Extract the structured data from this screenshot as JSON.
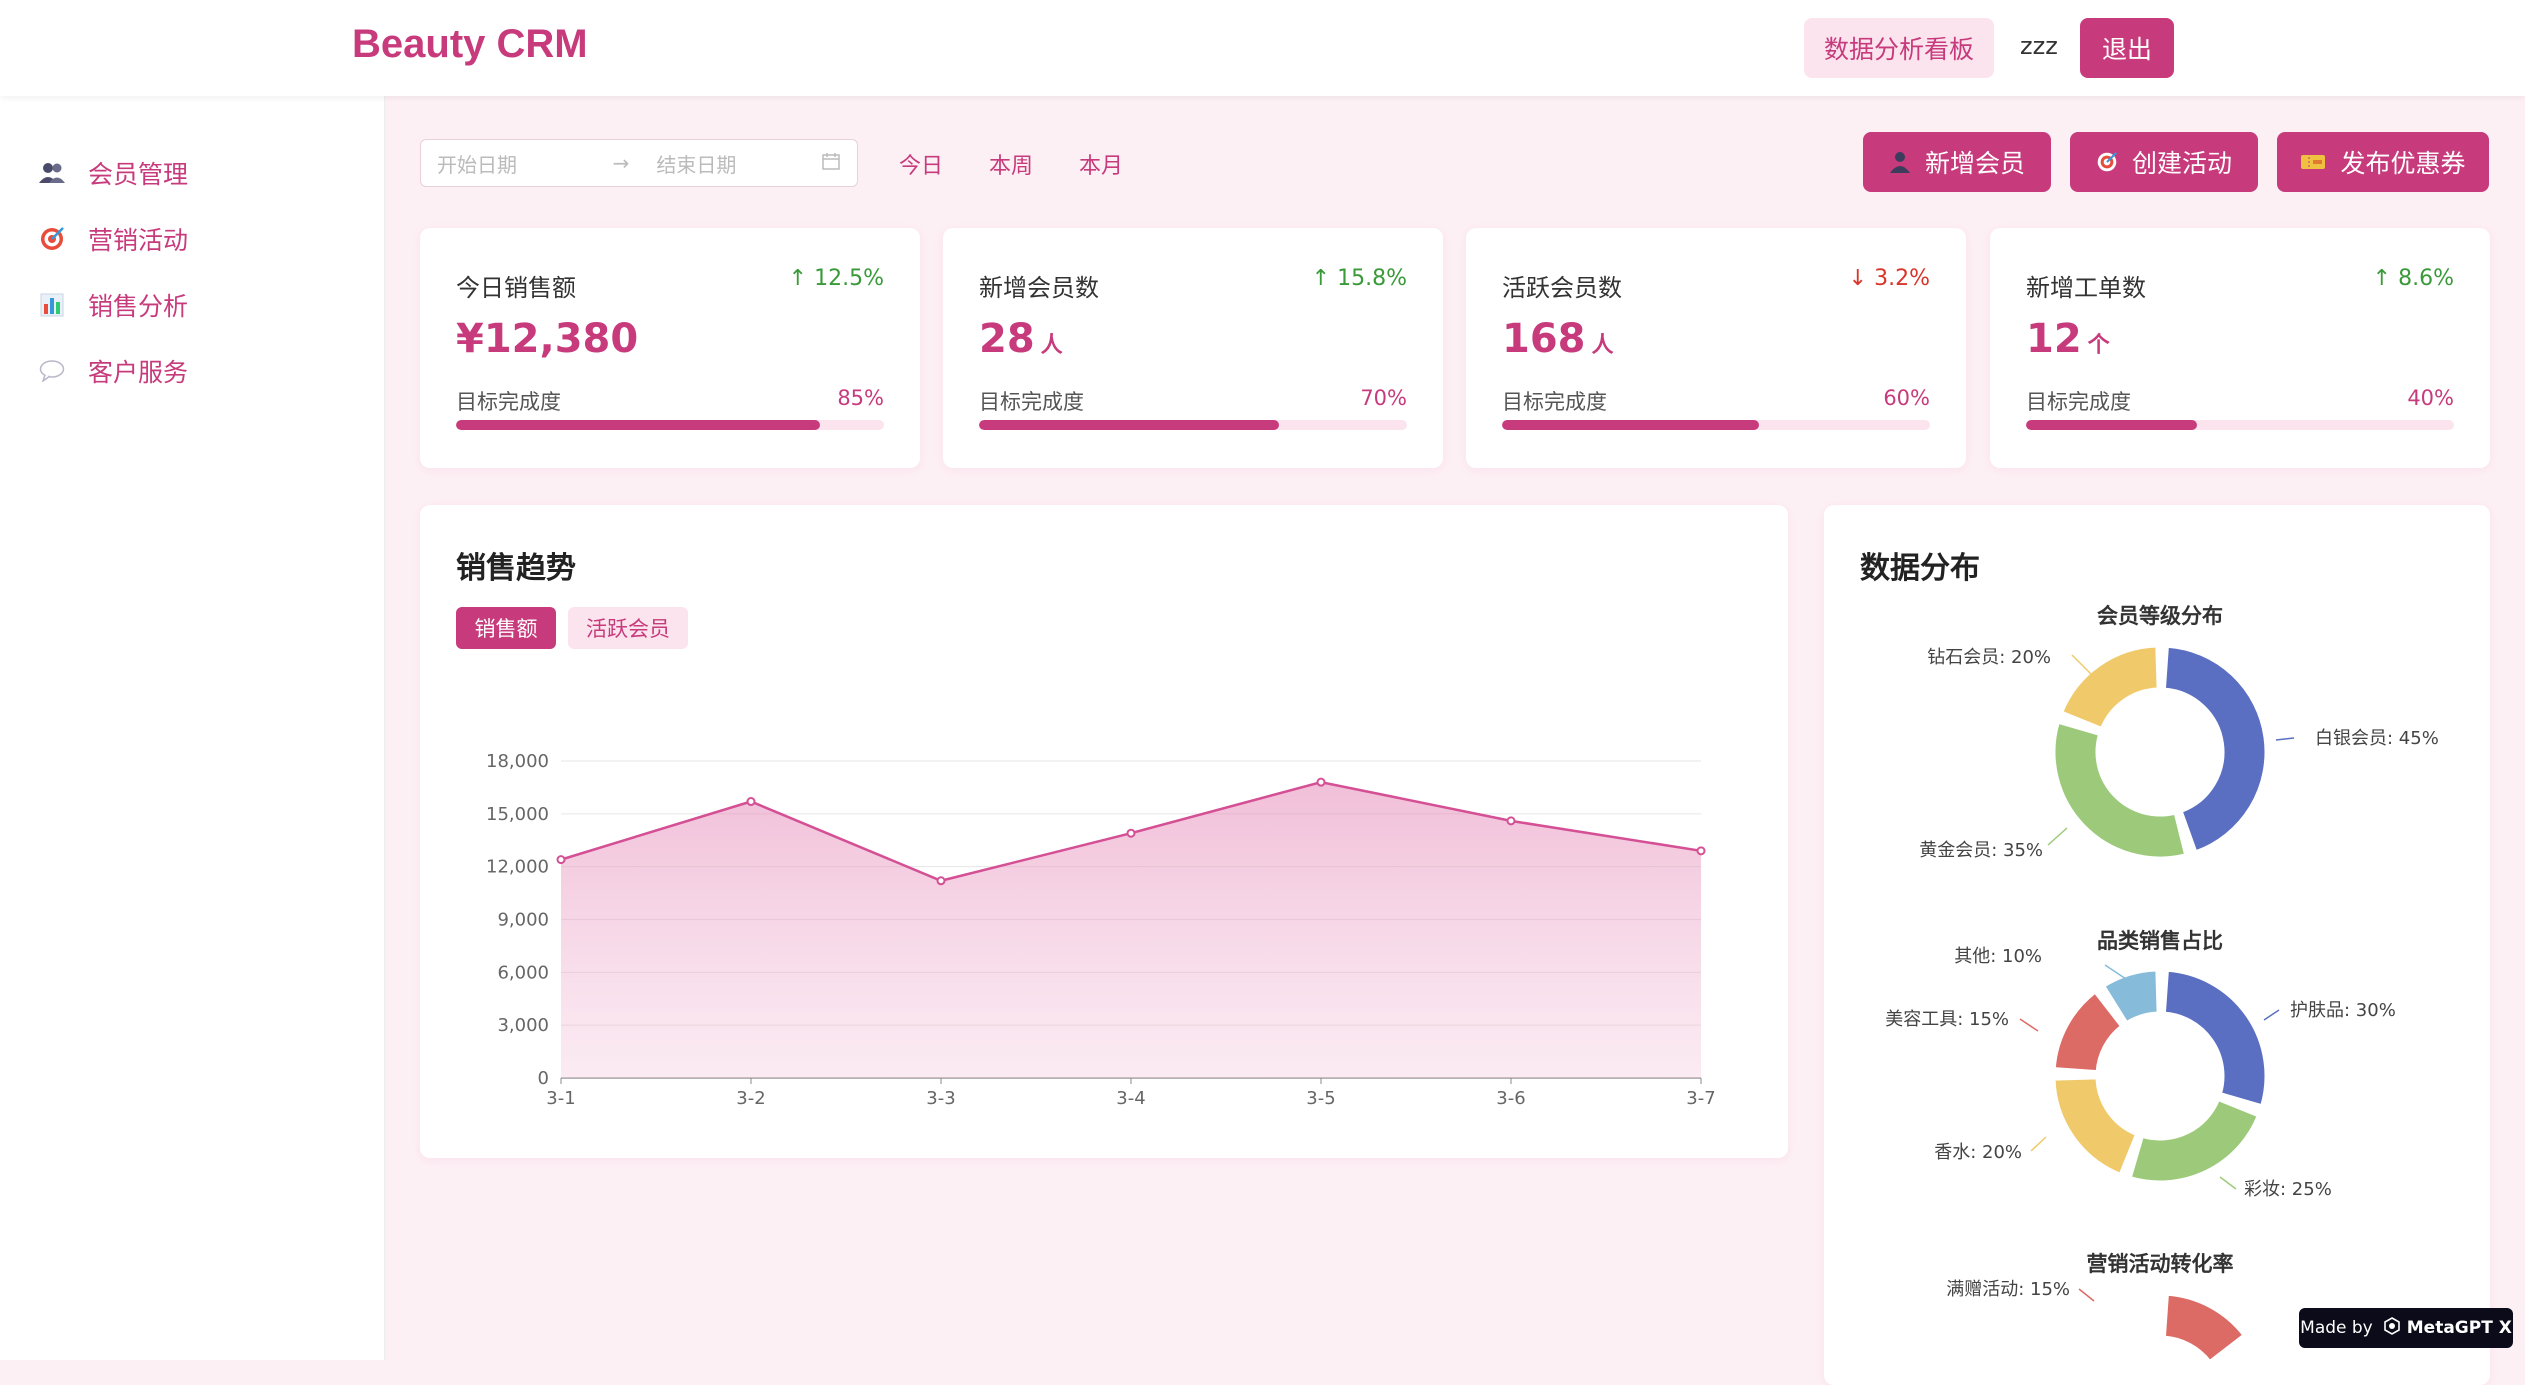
{
  "header": {
    "brand": "Beauty CRM",
    "dashboard_label": "数据分析看板",
    "username": "zzz",
    "logout_label": "退出"
  },
  "sidebar": {
    "items": [
      {
        "label": "会员管理",
        "icon": "users-icon"
      },
      {
        "label": "营销活动",
        "icon": "target-icon"
      },
      {
        "label": "销售分析",
        "icon": "bar-chart-icon"
      },
      {
        "label": "客户服务",
        "icon": "chat-bubble-icon"
      }
    ]
  },
  "toolbar": {
    "start_placeholder": "开始日期",
    "end_placeholder": "结束日期",
    "arrow": "→",
    "quick_today": "今日",
    "quick_week": "本周",
    "quick_month": "本月",
    "btn_add_member": "新增会员",
    "btn_create_campaign": "创建活动",
    "btn_publish_coupon": "发布优惠券"
  },
  "stats": [
    {
      "title": "今日销售额",
      "value": "¥12,380",
      "unit": "",
      "change": "↑ 12.5%",
      "trend": "up",
      "progress_label": "目标完成度",
      "progress": 85,
      "progress_text": "85%"
    },
    {
      "title": "新增会员数",
      "value": "28",
      "unit": "人",
      "change": "↑ 15.8%",
      "trend": "up",
      "progress_label": "目标完成度",
      "progress": 70,
      "progress_text": "70%"
    },
    {
      "title": "活跃会员数",
      "value": "168",
      "unit": "人",
      "change": "↓ 3.2%",
      "trend": "down",
      "progress_label": "目标完成度",
      "progress": 60,
      "progress_text": "60%"
    },
    {
      "title": "新增工单数",
      "value": "12",
      "unit": "个",
      "change": "↑ 8.6%",
      "trend": "up",
      "progress_label": "目标完成度",
      "progress": 40,
      "progress_text": "40%"
    }
  ],
  "colors": {
    "accent": "#c73b7c",
    "up": "#3a9a3a",
    "down": "#d9362b",
    "line": "#d44f94"
  },
  "trend_panel": {
    "title": "销售趋势",
    "tab_sales": "销售额",
    "tab_active": "活跃会员"
  },
  "dist_panel": {
    "title": "数据分布"
  },
  "badge": {
    "made_by": "Made by",
    "brand": "MetaGPT X"
  },
  "chart_data": [
    {
      "type": "area",
      "categories": [
        "3-1",
        "3-2",
        "3-3",
        "3-4",
        "3-5",
        "3-6",
        "3-7"
      ],
      "series": [
        {
          "values": [
            12400,
            15700,
            11200,
            13900,
            16800,
            14600,
            12900
          ]
        }
      ],
      "yticks": [
        "0",
        "3,000",
        "6,000",
        "9,000",
        "12,000",
        "15,000",
        "18,000"
      ],
      "ylim": [
        0,
        18000
      ],
      "grid": true
    },
    {
      "type": "pie",
      "title": "会员等级分布",
      "slices": [
        {
          "label": "白银会员: 45%",
          "value": 45,
          "color": "#5b6fc2"
        },
        {
          "label": "黄金会员: 35%",
          "value": 35,
          "color": "#9cca7a"
        },
        {
          "label": "钻石会员: 20%",
          "value": 20,
          "color": "#f0ca6a"
        }
      ]
    },
    {
      "type": "pie",
      "title": "品类销售占比",
      "slices": [
        {
          "label": "护肤品: 30%",
          "value": 30,
          "color": "#5b6fc2"
        },
        {
          "label": "彩妆: 25%",
          "value": 25,
          "color": "#9cca7a"
        },
        {
          "label": "香水: 20%",
          "value": 20,
          "color": "#f0ca6a"
        },
        {
          "label": "美容工具: 15%",
          "value": 15,
          "color": "#dc6b66"
        },
        {
          "label": "其他: 10%",
          "value": 10,
          "color": "#86bcd9"
        }
      ]
    },
    {
      "type": "pie",
      "title": "营销活动转化率",
      "slices": [
        {
          "label": "满赠活动: 15%",
          "value": 15,
          "color": "#dc6b66"
        }
      ]
    }
  ]
}
